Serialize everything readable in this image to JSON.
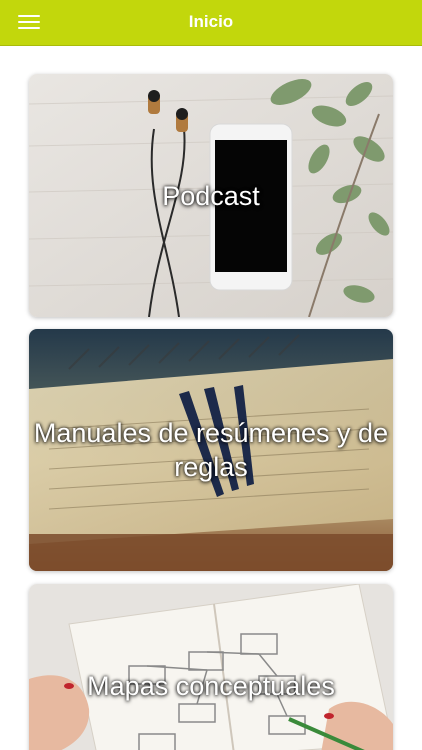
{
  "header": {
    "title": "Inicio"
  },
  "cards": [
    {
      "label": "Podcast"
    },
    {
      "label": "Manuales de resúmenes y de reglas"
    },
    {
      "label": "Mapas conceptuales"
    }
  ],
  "colors": {
    "accent": "#c2d70c",
    "header_text": "#ffffff"
  },
  "icons": {
    "menu": "hamburger-menu-icon"
  }
}
